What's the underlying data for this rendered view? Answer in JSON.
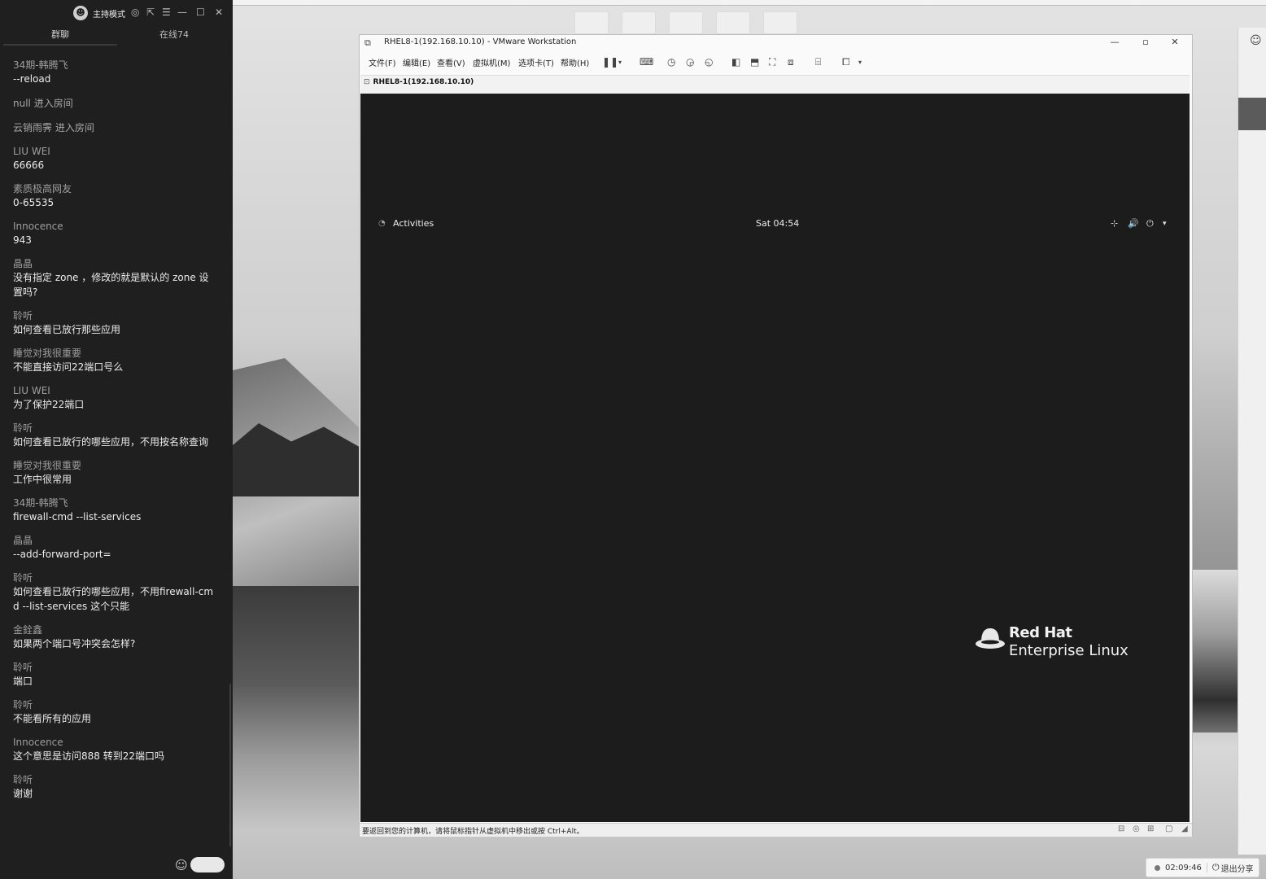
{
  "chat": {
    "mode_label": "主持模式",
    "tabs": {
      "group": "群聊",
      "online": "在线74"
    },
    "messages": [
      {
        "sender": "34期-韩腾飞",
        "text": "--reload"
      },
      {
        "sender": "",
        "text": "null 进入房间",
        "system": true
      },
      {
        "sender": "",
        "text": "云销雨霁 进入房间",
        "system": true
      },
      {
        "sender": "LIU WEI",
        "text": "66666"
      },
      {
        "sender": "素质极高网友",
        "text": "0-65535"
      },
      {
        "sender": "Innocence",
        "text": "943"
      },
      {
        "sender": "晶晶",
        "text": "没有指定 zone ，修改的就是默认的 zone 设置吗?"
      },
      {
        "sender": "聆听",
        "text": "如何查看已放行那些应用"
      },
      {
        "sender": "睡觉对我很重要",
        "text": "不能直接访问22端口号么"
      },
      {
        "sender": "LIU WEI",
        "text": "为了保护22端口"
      },
      {
        "sender": "聆听",
        "text": "如何查看已放行的哪些应用，不用按名称查询"
      },
      {
        "sender": "睡觉对我很重要",
        "text": "工作中很常用"
      },
      {
        "sender": "34期-韩腾飞",
        "text": "firewall-cmd --list-services"
      },
      {
        "sender": "晶晶",
        "text": "--add-forward-port="
      },
      {
        "sender": "聆听",
        "text": "如何查看已放行的哪些应用，不用firewall-cmd --list-services 这个只能"
      },
      {
        "sender": "金銓鑫",
        "text": "如果两个端口号冲突会怎样?"
      },
      {
        "sender": "聆听",
        "text": "端口"
      },
      {
        "sender": "聆听",
        "text": "不能看所有的应用"
      },
      {
        "sender": "Innocence",
        "text": "这个意思是访问888 转到22端口吗"
      },
      {
        "sender": "聆听",
        "text": "谢谢"
      }
    ]
  },
  "vmware": {
    "title": "RHEL8-1(192.168.10.10) - VMware Workstation",
    "menu": [
      "文件(F)",
      "编辑(E)",
      "查看(V)",
      "虚拟机(M)",
      "选项卡(T)",
      "帮助(H)"
    ],
    "tab_label": "RHEL8-1(192.168.10.10)",
    "status_text": "要返回到您的计算机，请将鼠标指针从虚拟机中移出或按 Ctrl+Alt。"
  },
  "guest": {
    "activities": "Activities",
    "clock": "Sat 04:54",
    "logo_line1": "Red Hat",
    "logo_line2": "Enterprise Linux"
  },
  "share_bar": {
    "timer": "02:09:46",
    "exit_label": "退出分享"
  }
}
